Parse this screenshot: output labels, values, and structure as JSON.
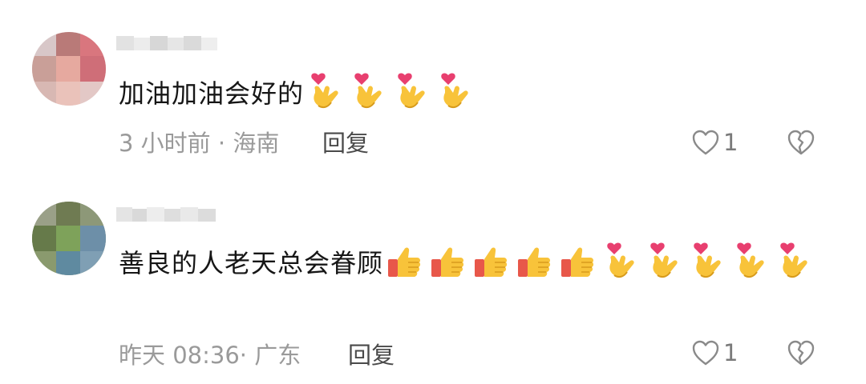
{
  "comments": [
    {
      "text": "加油加油会好的",
      "emojis": [
        "finger-heart-emoji",
        "finger-heart-emoji",
        "finger-heart-emoji",
        "finger-heart-emoji"
      ],
      "meta": "3 小时前 · 海南",
      "reply_label": "回复",
      "like_count": "1"
    },
    {
      "text": "善良的人老天总会眷顾",
      "emojis": [
        "thumbs-up-emoji",
        "thumbs-up-emoji",
        "thumbs-up-emoji",
        "thumbs-up-emoji",
        "thumbs-up-emoji",
        "finger-heart-emoji",
        "finger-heart-emoji",
        "finger-heart-emoji",
        "finger-heart-emoji",
        "finger-heart-emoji"
      ],
      "meta": "昨天 08:36· 广东",
      "reply_label": "回复",
      "like_count": "1"
    }
  ],
  "colors": {
    "text": "#161616",
    "meta": "#9a9a9a",
    "reply": "#4a4a4a",
    "icon": "#8a8a8a",
    "emoji_yellow": "#f8c33a",
    "emoji_heart": "#e83f6f",
    "emoji_sleeve": "#e8574a"
  },
  "icons": [
    "like-heart-icon",
    "dislike-broken-heart-icon"
  ]
}
